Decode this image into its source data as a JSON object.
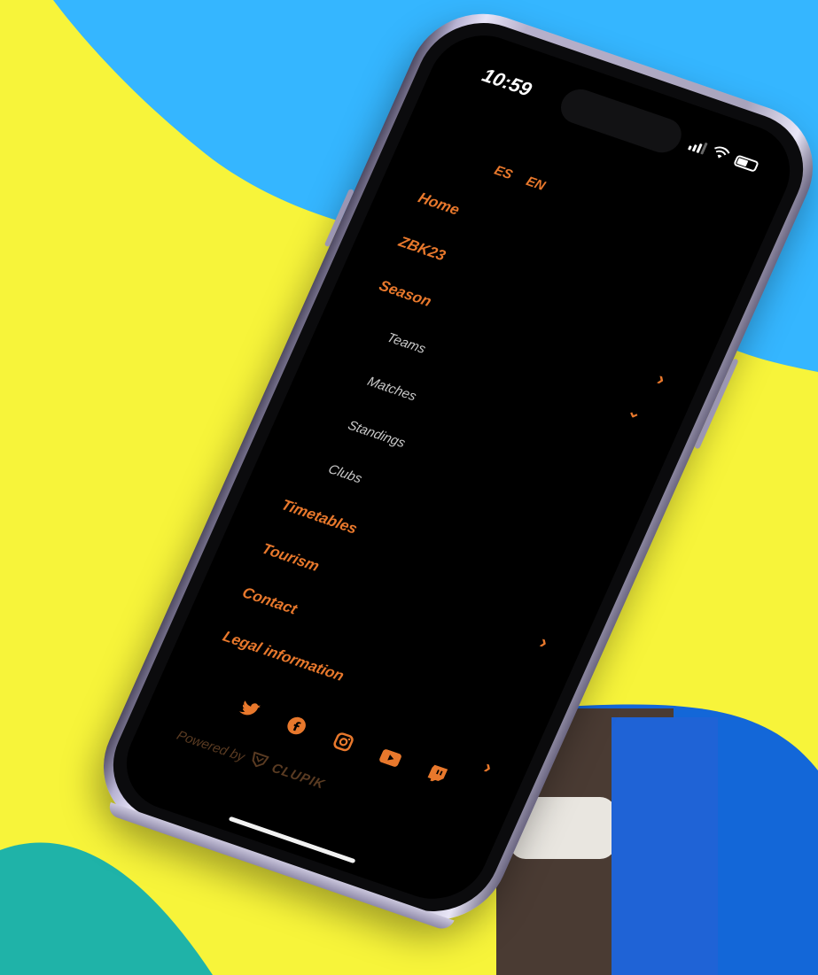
{
  "status_bar": {
    "time": "10:59"
  },
  "languages": [
    "ES",
    "EN"
  ],
  "menu": {
    "items": [
      {
        "label": "Home",
        "kind": "main"
      },
      {
        "label": "ZBK23",
        "kind": "main"
      },
      {
        "label": "Season",
        "kind": "main"
      },
      {
        "label": "Teams",
        "kind": "sub"
      },
      {
        "label": "Matches",
        "kind": "sub"
      },
      {
        "label": "Standings",
        "kind": "sub"
      },
      {
        "label": "Clubs",
        "kind": "sub"
      },
      {
        "label": "Timetables",
        "kind": "main"
      },
      {
        "label": "Tourism",
        "kind": "main"
      },
      {
        "label": "Contact",
        "kind": "main"
      },
      {
        "label": "Legal information",
        "kind": "main"
      }
    ]
  },
  "social_icons": [
    "twitter-icon",
    "facebook-icon",
    "instagram-icon",
    "youtube-icon",
    "twitch-icon"
  ],
  "footer": {
    "powered_by": "Powered by",
    "brand": "CLUPIK"
  },
  "colors": {
    "accent": "#e8782c",
    "submenu_text": "#c9c9c9",
    "background_blue": "#35b6ff",
    "background_yellow": "#f7f43a",
    "screen": "#000000"
  }
}
